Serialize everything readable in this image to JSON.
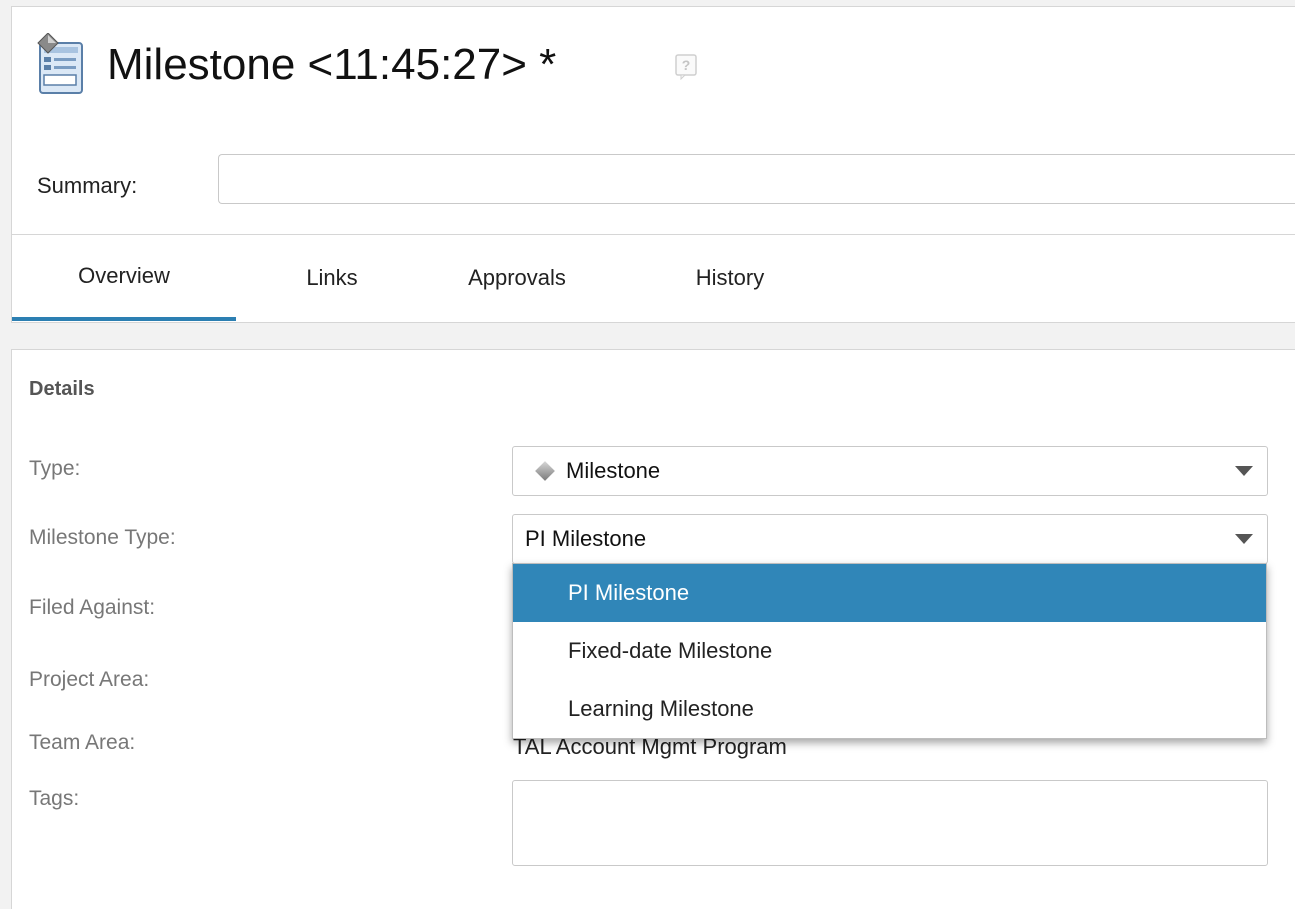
{
  "header": {
    "title": "Milestone <11:45:27> *",
    "summary_label": "Summary:",
    "summary_value": ""
  },
  "tabs": [
    {
      "label": "Overview",
      "active": true
    },
    {
      "label": "Links",
      "active": false
    },
    {
      "label": "Approvals",
      "active": false
    },
    {
      "label": "History",
      "active": false
    }
  ],
  "details": {
    "section_title": "Details",
    "fields": {
      "type": {
        "label": "Type:",
        "value": "Milestone",
        "icon": "diamond-icon"
      },
      "milestone_type": {
        "label": "Milestone Type:",
        "value": "PI Milestone"
      },
      "filed_against": {
        "label": "Filed Against:"
      },
      "project_area": {
        "label": "Project Area:"
      },
      "team_area": {
        "label": "Team Area:",
        "value": "TAL Account Mgmt Program"
      },
      "tags": {
        "label": "Tags:",
        "value": ""
      }
    }
  },
  "dropdown": {
    "options": [
      "PI Milestone",
      "Fixed-date Milestone",
      "Learning Milestone"
    ],
    "selected": "PI Milestone"
  },
  "colors": {
    "accent": "#2c7fb2",
    "selected_option_bg": "#3086b8",
    "label_gray": "#777777"
  }
}
